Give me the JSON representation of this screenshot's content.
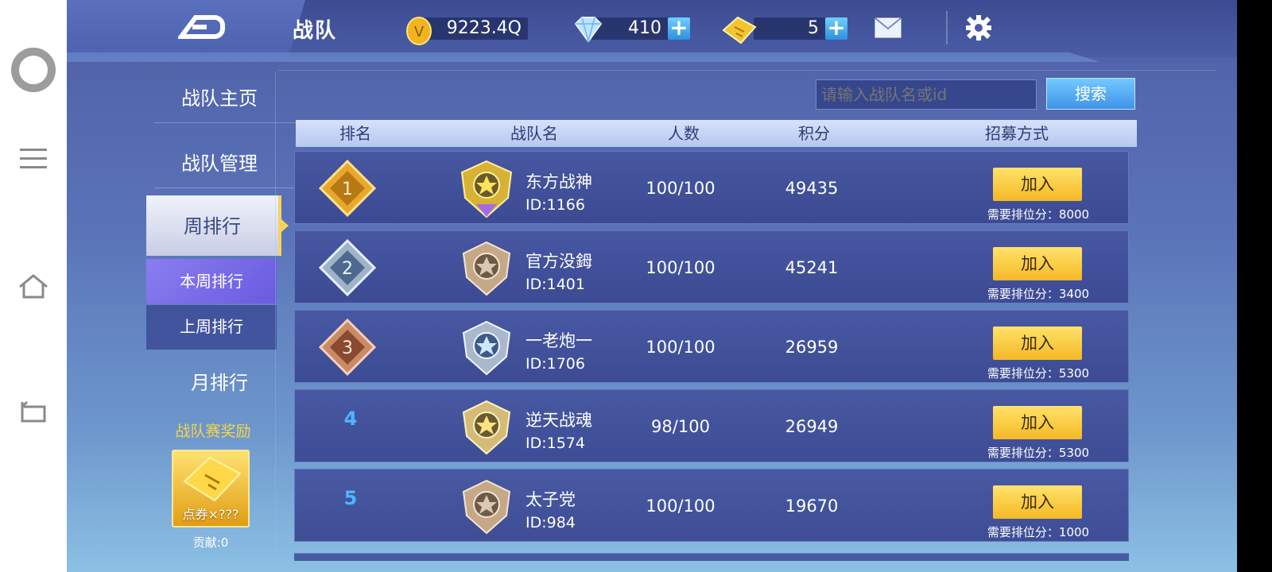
{
  "header": {
    "title": "战队",
    "gold": "9223.4Q",
    "diamonds": "410",
    "tickets": "5"
  },
  "search": {
    "placeholder": "请输入战队名或id",
    "button": "搜索"
  },
  "nav": {
    "home": "战队主页",
    "manage": "战队管理",
    "weekly": "周排行",
    "this_week": "本周排行",
    "last_week": "上周排行",
    "monthly": "月排行",
    "reward_title": "战队赛奖励",
    "reward_label": "点券×???",
    "contribution": "贡献:0"
  },
  "table": {
    "headers": [
      "排名",
      "战队名",
      "人数",
      "积分",
      "招募方式"
    ],
    "join_label": "加入",
    "rows": [
      {
        "rank": "1",
        "name": "东方战神",
        "id": "ID:1166",
        "members": "100/100",
        "score": "49435",
        "requirement": "需要排位分：8000"
      },
      {
        "rank": "2",
        "name": "官方没鉧",
        "id": "ID:1401",
        "members": "100/100",
        "score": "45241",
        "requirement": "需要排位分：3400"
      },
      {
        "rank": "3",
        "name": "一老炮一",
        "id": "ID:1706",
        "members": "100/100",
        "score": "26959",
        "requirement": "需要排位分：5300"
      },
      {
        "rank": "4",
        "name": "逆天战魂",
        "id": "ID:1574",
        "members": "98/100",
        "score": "26949",
        "requirement": "需要排位分：5300"
      },
      {
        "rank": "5",
        "name": "太子党",
        "id": "ID:984",
        "members": "100/100",
        "score": "19670",
        "requirement": "需要排位分：1000"
      }
    ]
  },
  "colors": {
    "accent_gold": "#f5c030",
    "accent_blue": "#4fb6ff",
    "panel": "#4a5aa5"
  },
  "icons": [
    "recents-circle-icon",
    "menu-icon",
    "home-icon",
    "back-icon",
    "logo-back-icon",
    "coin-icon",
    "diamond-icon",
    "ticket-icon",
    "plus-icon",
    "mail-icon",
    "gear-icon",
    "medal-icon",
    "team-emblem-icon"
  ]
}
